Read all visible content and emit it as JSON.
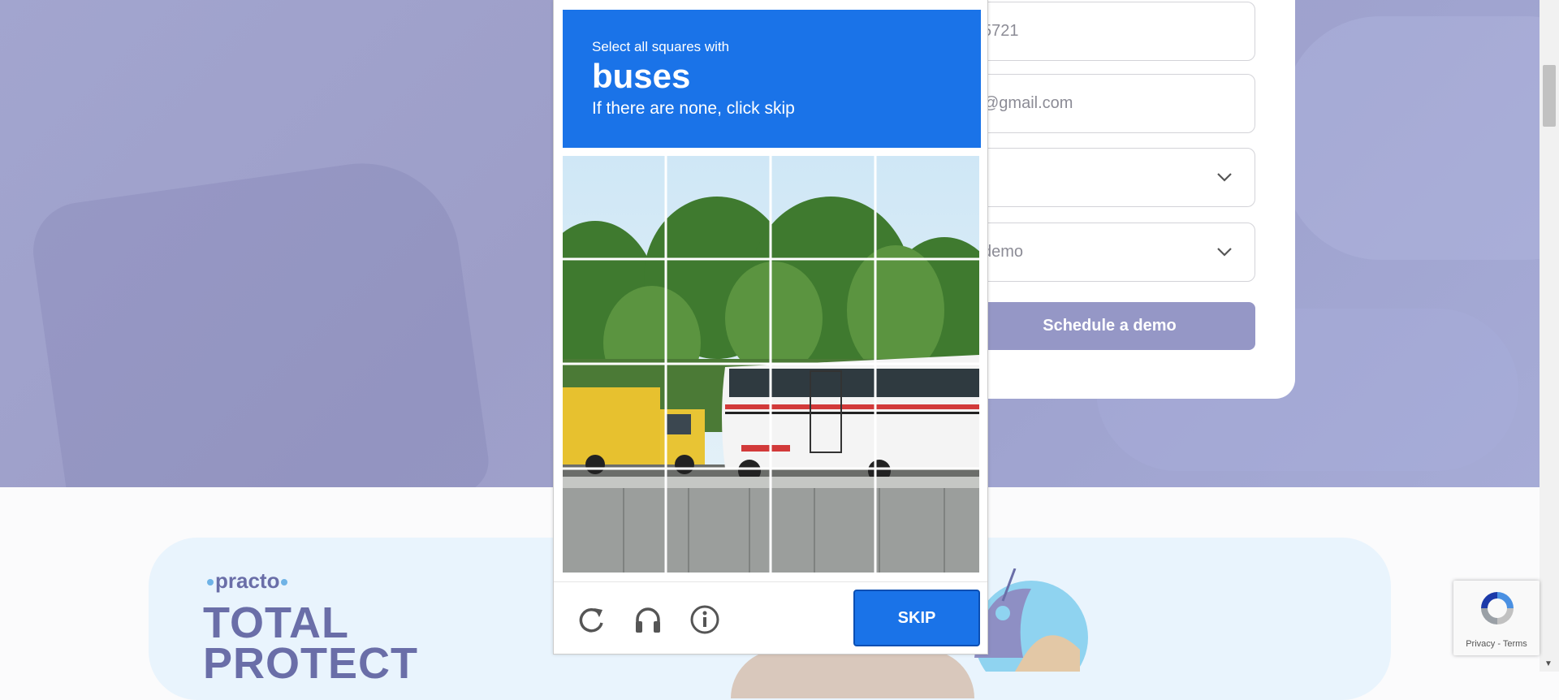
{
  "form": {
    "phone_value": "5721",
    "email_value": "@gmail.com",
    "select1_value": "",
    "select2_value": "demo",
    "schedule_label": "Schedule a demo"
  },
  "promo": {
    "brand": "practo",
    "title_line1": "TOTAL",
    "title_line2": "PROTECT"
  },
  "captcha": {
    "line1": "Select all squares with",
    "target": "buses",
    "line3": "If there are none, click skip",
    "skip_label": "SKIP",
    "grid_rows": 4,
    "grid_cols": 4,
    "icons": [
      "reload-icon",
      "audio-icon",
      "info-icon"
    ]
  },
  "recaptcha_badge": {
    "links": "Privacy - Terms"
  },
  "colors": {
    "captcha_blue": "#1a73e8",
    "schedule_button": "#9597c6",
    "hero_bg": "#a2a5cf"
  }
}
